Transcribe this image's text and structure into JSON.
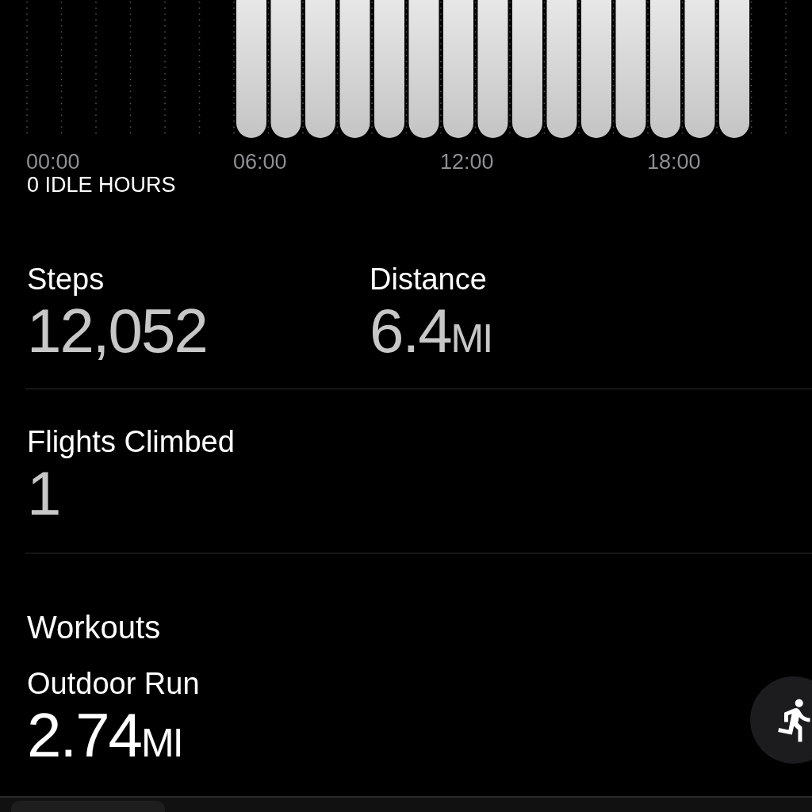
{
  "stand_chart": {
    "x_labels": [
      "00:00",
      "06:00",
      "12:00",
      "18:00"
    ],
    "summary": "0 IDLE HOURS"
  },
  "stats": [
    {
      "label": "Steps",
      "value": "12,052"
    },
    {
      "label": "Distance",
      "value": "6.4",
      "unit": "MI"
    }
  ],
  "flights": {
    "label": "Flights Climbed",
    "value": "1"
  },
  "workouts": {
    "title": "Workouts",
    "items": [
      {
        "name": "Outdoor Run",
        "value": "2.74",
        "unit": "MI"
      }
    ]
  }
}
